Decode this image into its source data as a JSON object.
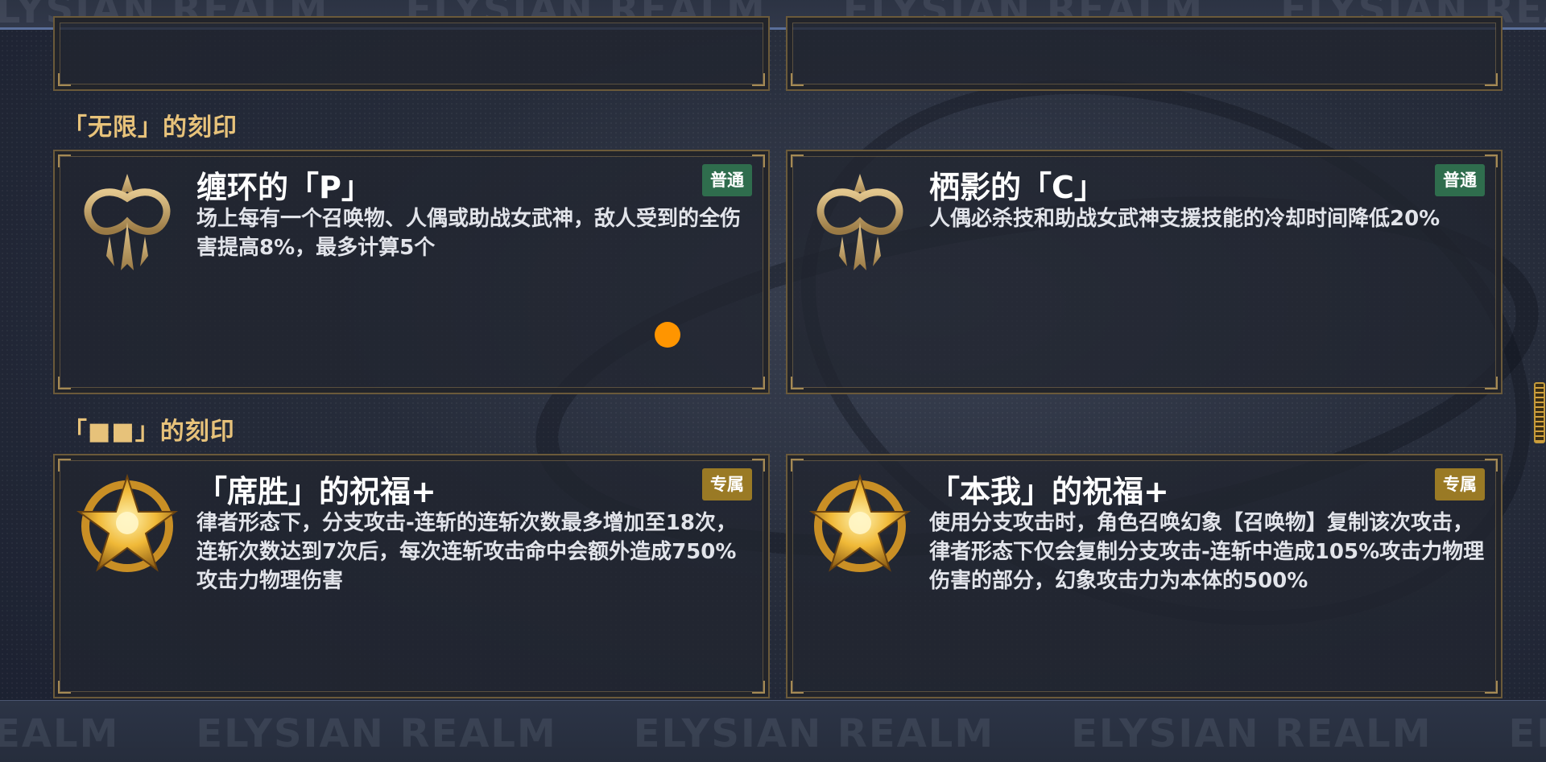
{
  "watermark": {
    "top": [
      "ELYSIAN REALM",
      "ELYSIAN REALM",
      "ELYSIAN REALM",
      "ELYSIAN REALM"
    ],
    "bottom": [
      "ELYSIAN REALM",
      "ELYSIAN REALM",
      "ELYSIAN REALM",
      "ELYSIAN REALM",
      "ELYSIAN REALM"
    ]
  },
  "colors": {
    "section_title": "#e7c27a",
    "badge_normal": "#2f6d4d",
    "badge_exclusive": "#9a7a25",
    "highlight_dot": "#ff9500"
  },
  "sections": [
    {
      "title": "「无限」的刻印",
      "cards": [
        {
          "icon": "infinity-sigil-icon",
          "title": "缠环的「P」",
          "badge": "普通",
          "desc": "场上每有一个召唤物、人偶或助战女武神，敌人受到的全伤害提高8%，最多计算5个"
        },
        {
          "icon": "infinity-sigil-icon",
          "title": "栖影的「C」",
          "badge": "普通",
          "desc": "人偶必杀技和助战女武神支援技能的冷却时间降低20%"
        }
      ]
    },
    {
      "title": "「■■」的刻印",
      "cards": [
        {
          "icon": "golden-star-sigil-icon",
          "title": "「席胜」的祝福+",
          "badge": "专属",
          "desc": "律者形态下，分支攻击-连斩的连斩次数最多增加至18次，连斩次数达到7次后，每次连斩攻击命中会额外造成750%攻击力物理伤害"
        },
        {
          "icon": "golden-star-sigil-icon",
          "title": "「本我」的祝福+",
          "badge": "专属",
          "desc": "使用分支攻击时，角色召唤幻象【召唤物】复制该次攻击，律者形态下仅会复制分支攻击-连斩中造成105%攻击力物理伤害的部分，幻象攻击力为本体的500%"
        }
      ]
    }
  ]
}
